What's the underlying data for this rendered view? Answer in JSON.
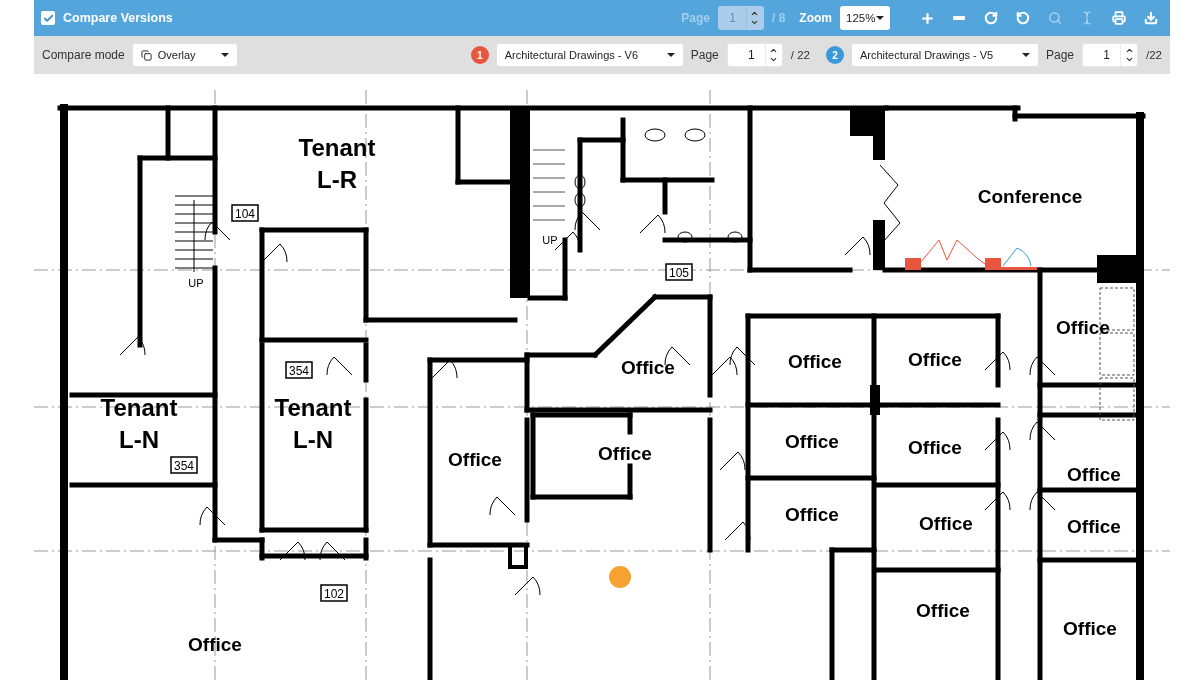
{
  "window": {
    "title": "Compare Versions",
    "checked": true
  },
  "page_nav": {
    "label": "Page",
    "value": "1",
    "total": "/ 8",
    "disabled": true
  },
  "zoom": {
    "label": "Zoom",
    "value": "125%"
  },
  "tools": [
    {
      "kind": "zoom-in",
      "disabled": false
    },
    {
      "kind": "zoom-out",
      "disabled": false
    },
    {
      "kind": "rotate-right",
      "disabled": false
    },
    {
      "kind": "rotate-left",
      "disabled": false
    },
    {
      "kind": "search",
      "disabled": true
    },
    {
      "kind": "text-select",
      "disabled": true
    },
    {
      "kind": "print",
      "disabled": false
    },
    {
      "kind": "download",
      "disabled": false
    }
  ],
  "compare_mode": {
    "label": "Compare mode",
    "value": "Overlay"
  },
  "documents": [
    {
      "badge": "1",
      "color": "#e8563f",
      "value": "Architectural Drawings - V6",
      "page_label": "Page",
      "page": "1",
      "total": "/ 22"
    },
    {
      "badge": "2",
      "color": "#3a9ad9",
      "value": "Architectural Drawings - V5",
      "page_label": "Page",
      "page": "1",
      "total": "/22"
    }
  ],
  "plan": {
    "rooms": [
      {
        "lines": [
          "Tenant",
          "L-R"
        ]
      },
      {
        "lines": [
          "Conference"
        ]
      },
      {
        "lines": [
          "Office"
        ]
      },
      {
        "lines": [
          "Office"
        ]
      },
      {
        "lines": [
          "Office"
        ]
      },
      {
        "lines": [
          "Office"
        ]
      },
      {
        "lines": [
          "Tenant",
          "L-N"
        ]
      },
      {
        "lines": [
          "Tenant",
          "L-N"
        ]
      },
      {
        "lines": [
          "Office"
        ]
      },
      {
        "lines": [
          "Office"
        ]
      },
      {
        "lines": [
          "Office"
        ]
      },
      {
        "lines": [
          "Office"
        ]
      },
      {
        "lines": [
          "Office"
        ]
      },
      {
        "lines": [
          "Office"
        ]
      },
      {
        "lines": [
          "Office"
        ]
      },
      {
        "lines": [
          "Office"
        ]
      },
      {
        "lines": [
          "Office"
        ]
      },
      {
        "lines": [
          "Office"
        ]
      },
      {
        "lines": [
          "Office"
        ]
      }
    ],
    "tags": [
      "104",
      "105",
      "354",
      "354",
      "102"
    ],
    "stair_labels": [
      "UP",
      "UP"
    ]
  }
}
